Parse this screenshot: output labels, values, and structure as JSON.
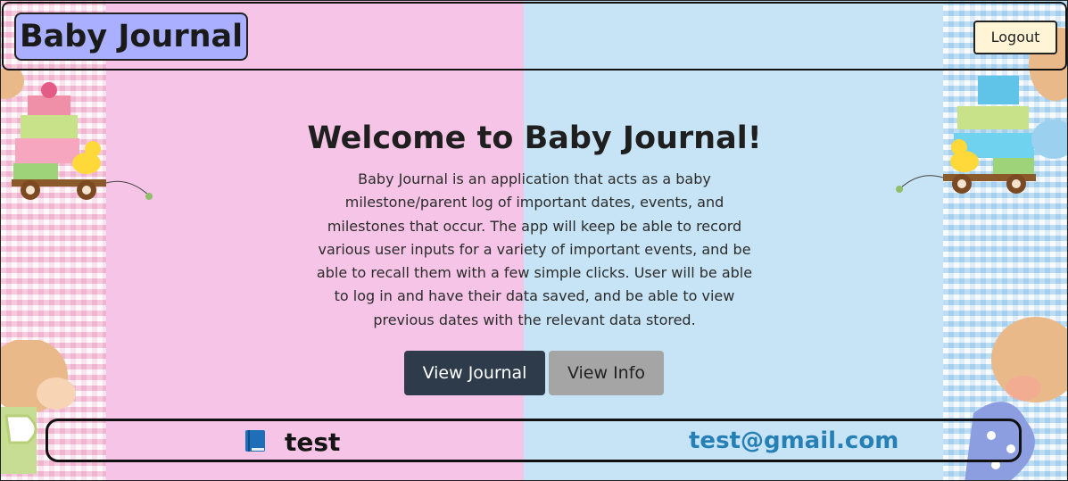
{
  "header": {
    "brand": "Baby Journal",
    "logout_label": "Logout"
  },
  "hero": {
    "title": "Welcome to Baby Journal!",
    "description": "Baby Journal is an application that acts as a baby milestone/parent log of important dates, events, and milestones that occur. The app will keep be able to record various user inputs for a variety of important events, and be able to recall them with a few simple clicks. User will be able to log in and have their data saved, and be able to view previous dates with the relevant data stored.",
    "buttons": {
      "journal_label": "View Journal",
      "info_label": "View Info"
    }
  },
  "footer": {
    "user_icon": "book-icon",
    "username": "test",
    "email": "test@gmail.com"
  },
  "colors": {
    "pink_panel": "#f6c4e6",
    "blue_panel": "#c6e4f5",
    "brand_bg": "#aab0ff",
    "logout_bg": "#fff5d6",
    "primary_button": "#2d3b4b",
    "secondary_button": "#a5a5a5",
    "email_text": "#2680b6"
  }
}
